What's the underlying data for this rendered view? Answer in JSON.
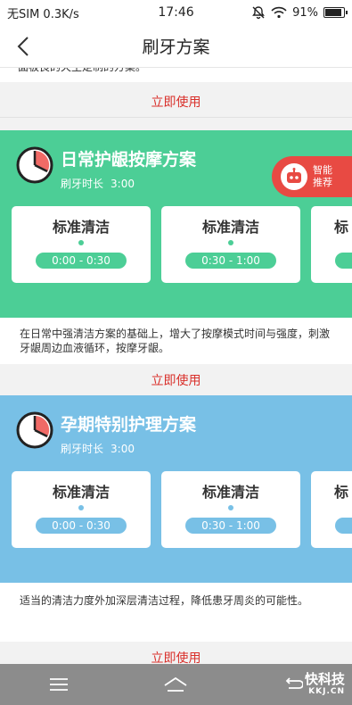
{
  "status": {
    "carrier": "无SIM 0.3K/s",
    "time": "17:46",
    "battery": "91%",
    "battery_level": 0.91
  },
  "nav": {
    "title": "刷牙方案"
  },
  "top_desc_partial": "面板良的天主定制的方案。",
  "use_label": "立即使用",
  "smart": {
    "line1": "智能",
    "line2": "推荐"
  },
  "plans": [
    {
      "title": "日常护龈按摩方案",
      "duration_label": "刷牙时长",
      "duration": "3:00",
      "cards": [
        {
          "title": "标准清洁",
          "time": "0:00 - 0:30"
        },
        {
          "title": "标准清洁",
          "time": "0:30 - 1:00"
        },
        {
          "title": "标"
        }
      ],
      "description": "在日常中强清洁方案的基础上，增大了按摩模式时间与强度，刺激牙龈周边血液循环，按摩牙龈。"
    },
    {
      "title": "孕期特别护理方案",
      "duration_label": "刷牙时长",
      "duration": "3:00",
      "cards": [
        {
          "title": "标准清洁",
          "time": "0:00 - 0:30"
        },
        {
          "title": "标准清洁",
          "time": "0:30 - 1:00"
        },
        {
          "title": "标"
        }
      ],
      "description": "适当的清洁力度外加深层清洁过程，降低患牙周炎的可能性。"
    }
  ],
  "watermark": {
    "main": "快科技",
    "sub": "KKJ.CN"
  },
  "colors": {
    "green": "#4cce96",
    "blue": "#78c0e6",
    "accent_red": "#d9302b",
    "clock_red": "#f06a66"
  }
}
